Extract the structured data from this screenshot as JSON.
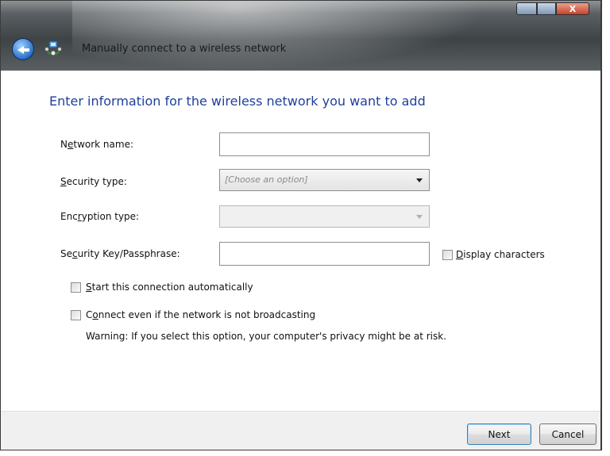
{
  "window": {
    "title": "Manually connect to a wireless network",
    "controls": {
      "minimize": "",
      "maximize": "",
      "close": "X"
    }
  },
  "main": {
    "heading": "Enter information for the wireless network you want to add",
    "network_name": {
      "label_pre": "N",
      "label_key": "e",
      "label_post": "twork name:",
      "value": ""
    },
    "security_type": {
      "label_pre": "",
      "label_key": "S",
      "label_post": "ecurity type:",
      "selected": "[Choose an option]"
    },
    "encryption_type": {
      "label_pre": "Enc",
      "label_key": "r",
      "label_post": "yption type:",
      "selected": ""
    },
    "security_key": {
      "label_pre": "Se",
      "label_key": "c",
      "label_post": "urity Key/Passphrase:",
      "value": ""
    },
    "display_characters": {
      "label_pre": "",
      "label_key": "D",
      "label_post": "isplay characters",
      "checked": false
    },
    "start_auto": {
      "label_pre": "",
      "label_key": "S",
      "label_post": "tart this connection automatically",
      "checked": false
    },
    "connect_hidden": {
      "label_pre": "C",
      "label_key": "o",
      "label_post": "nnect even if the network is not broadcasting",
      "checked": false
    },
    "warning": "Warning: If you select this option, your computer's privacy might be at risk."
  },
  "footer": {
    "next_label": "Next",
    "cancel_label": "Cancel"
  },
  "icons": {
    "back": "back-arrow-icon",
    "network": "wireless-network-icon"
  },
  "colors": {
    "heading": "#1e3f9c",
    "titlebar": "#3e4346"
  }
}
